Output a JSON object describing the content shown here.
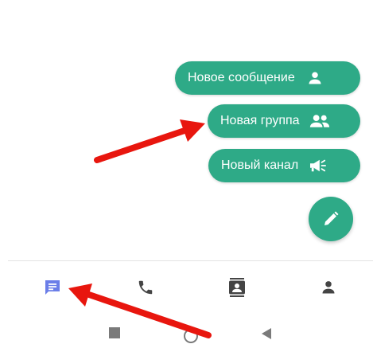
{
  "fab_menu": {
    "items": [
      {
        "label": "Новое сообщение",
        "icon": "person-icon"
      },
      {
        "label": "Новая группа",
        "icon": "group-icon"
      },
      {
        "label": "Новый канал",
        "icon": "megaphone-icon"
      }
    ],
    "fab_icon": "pencil-icon"
  },
  "bottom_nav": {
    "items": [
      {
        "id": "chats",
        "icon": "chat-icon",
        "active": true
      },
      {
        "id": "calls",
        "icon": "phone-icon",
        "active": false
      },
      {
        "id": "contacts",
        "icon": "contacts-icon",
        "active": false
      },
      {
        "id": "profile",
        "icon": "person-icon",
        "active": false
      }
    ]
  },
  "system_nav": {
    "buttons": [
      "recents-icon",
      "home-icon",
      "back-icon"
    ]
  },
  "colors": {
    "accent": "#2eaa87",
    "active_nav": "#6b7ee8",
    "inactive_nav": "#444444",
    "arrow": "#e8160e"
  }
}
